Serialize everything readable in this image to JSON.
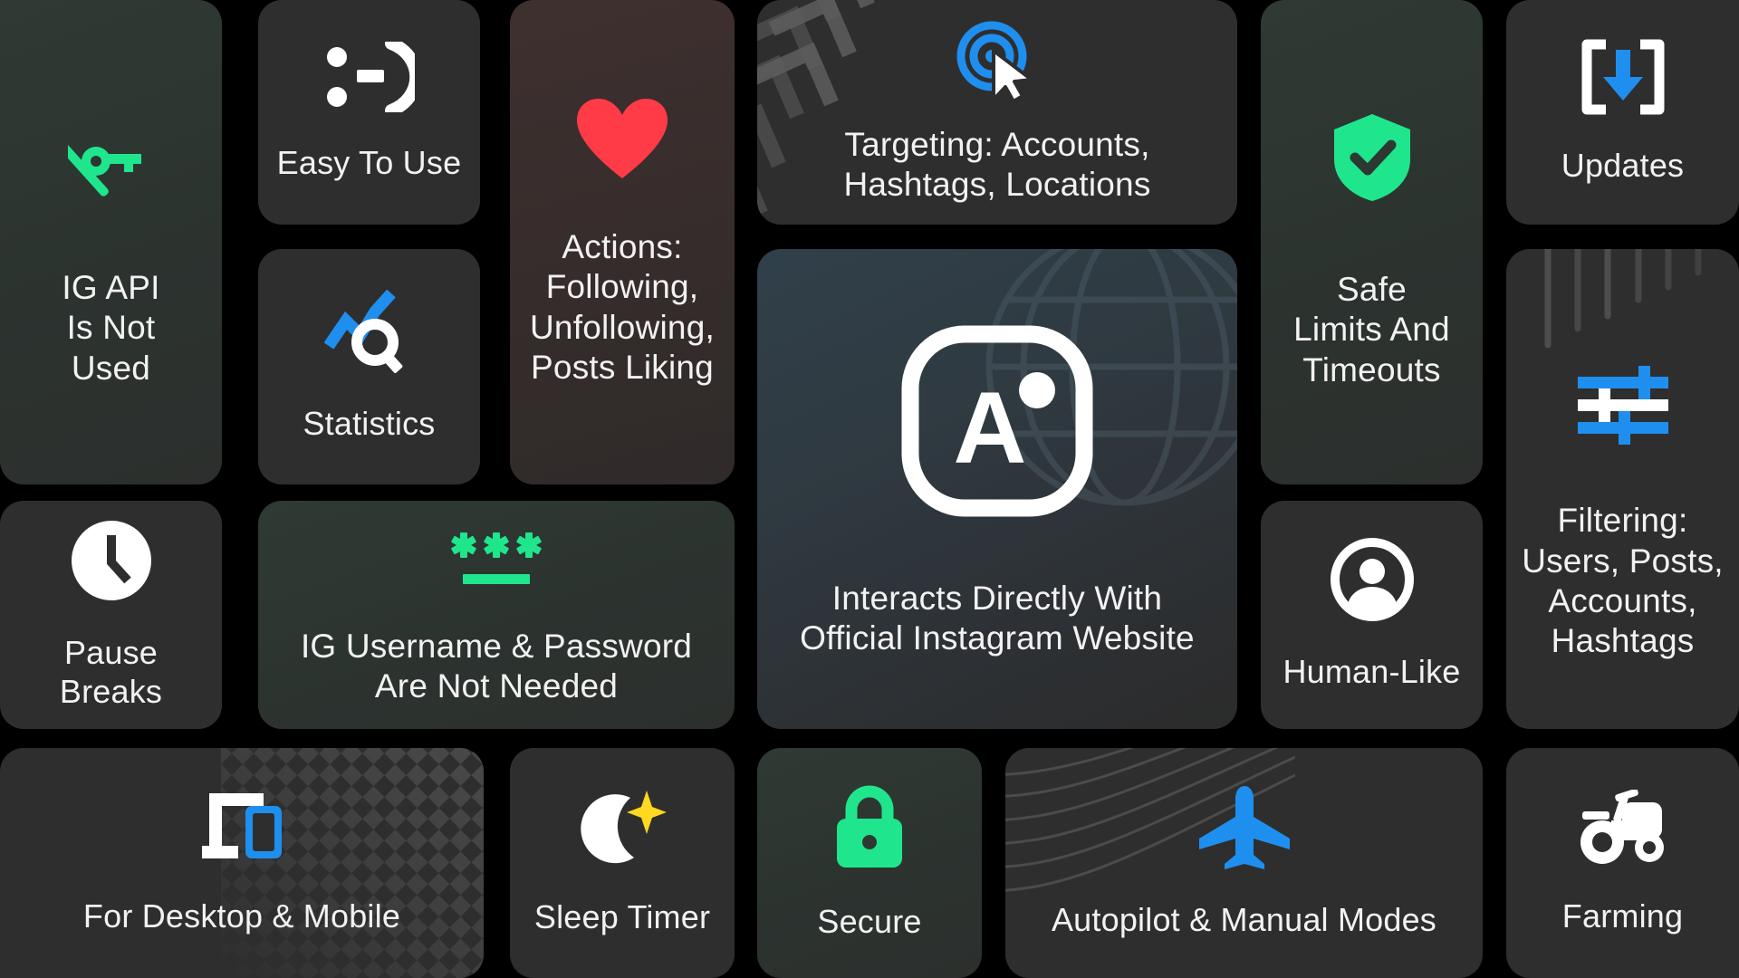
{
  "palette": {
    "background": "#000000",
    "tile_dark": "#2e2e2e",
    "tile_green": "#2d3833",
    "tile_red": "#3a2e2e",
    "tile_center": "#2f3b42",
    "accent_green": "#1fe68c",
    "accent_blue": "#1f8fef",
    "accent_red": "#ff3b47",
    "accent_yellow": "#ffd91f",
    "text": "#f2f2f2"
  },
  "tiles": {
    "ig_api": {
      "label": "IG API\nIs Not\nUsed",
      "icon": "key-off-icon",
      "tone": "green"
    },
    "easy": {
      "label": "Easy To Use",
      "icon": "smiley-face-icon",
      "tone": "dark"
    },
    "actions": {
      "label": "Actions:\nFollowing,\nUnfollowing,\nPosts Liking",
      "icon": "heart-icon",
      "tone": "red"
    },
    "statistics": {
      "label": "Statistics",
      "icon": "chart-search-icon",
      "tone": "dark"
    },
    "targeting": {
      "label": "Targeting: Accounts,\nHashtags, Locations",
      "icon": "target-cursor-icon",
      "tone": "dark"
    },
    "center": {
      "label": "Interacts Directly With\nOfficial Instagram Website",
      "icon": "app-logo-icon",
      "tone": "center",
      "logo_letter": "A"
    },
    "safe": {
      "label": "Safe\nLimits And\nTimeouts",
      "icon": "shield-check-icon",
      "tone": "green"
    },
    "updates": {
      "label": "Updates",
      "icon": "download-box-icon",
      "tone": "dark"
    },
    "filtering": {
      "label": "Filtering:\nUsers, Posts,\nAccounts,\nHashtags",
      "icon": "sliders-icon",
      "tone": "dark"
    },
    "pause": {
      "label": "Pause Breaks",
      "icon": "clock-icon",
      "tone": "dark"
    },
    "credentials": {
      "label": "IG Username & Password\nAre Not Needed",
      "icon": "password-asterisks-icon",
      "tone": "green",
      "asterisks": "✳✳✳"
    },
    "human": {
      "label": "Human-Like",
      "icon": "person-circle-icon",
      "tone": "dark"
    },
    "desktop": {
      "label": "For Desktop & Mobile",
      "icon": "desktop-mobile-icon",
      "tone": "dark"
    },
    "sleep": {
      "label": "Sleep Timer",
      "icon": "moon-sparkle-icon",
      "tone": "dark"
    },
    "secure": {
      "label": "Secure",
      "icon": "lock-icon",
      "tone": "green"
    },
    "autopilot": {
      "label": "Autopilot & Manual Modes",
      "icon": "airplane-icon",
      "tone": "dark"
    },
    "farming": {
      "label": "Farming",
      "icon": "tractor-icon",
      "tone": "dark"
    }
  }
}
